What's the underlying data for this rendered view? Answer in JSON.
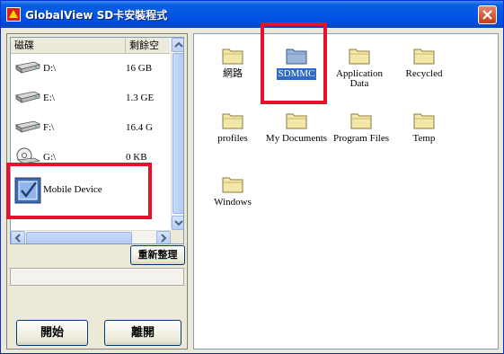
{
  "window": {
    "title": "GlobalView SD卡安裝程式"
  },
  "drive_list": {
    "columns": {
      "disk": "磁碟",
      "remaining": "剩餘空"
    },
    "drives": [
      {
        "label": "D:\\",
        "free": "16 GB",
        "icon": "hard-drive-icon"
      },
      {
        "label": "E:\\",
        "free": "1.3 GE",
        "icon": "hard-drive-icon"
      },
      {
        "label": "F:\\",
        "free": "16.4 G",
        "icon": "hard-drive-icon"
      },
      {
        "label": "G:\\",
        "free": "0 KB",
        "icon": "cd-drive-icon"
      }
    ],
    "mobile_device": {
      "label": "Mobile Device",
      "icon": "mobile-device-icon"
    }
  },
  "buttons": {
    "refresh": "重新整理",
    "start": "開始",
    "exit": "離開"
  },
  "folders": [
    {
      "label": "網路"
    },
    {
      "label": "SDMMC",
      "selected": true
    },
    {
      "label": "Application Data"
    },
    {
      "label": "Recycled"
    },
    {
      "label": "profiles"
    },
    {
      "label": "My Documents"
    },
    {
      "label": "Program Files"
    },
    {
      "label": "Temp"
    },
    {
      "label": "Windows"
    }
  ],
  "colors": {
    "title_bar": "#0054e3",
    "selection": "#316ac5",
    "highlight_box": "#e8102a",
    "close_button": "#c73b16"
  }
}
